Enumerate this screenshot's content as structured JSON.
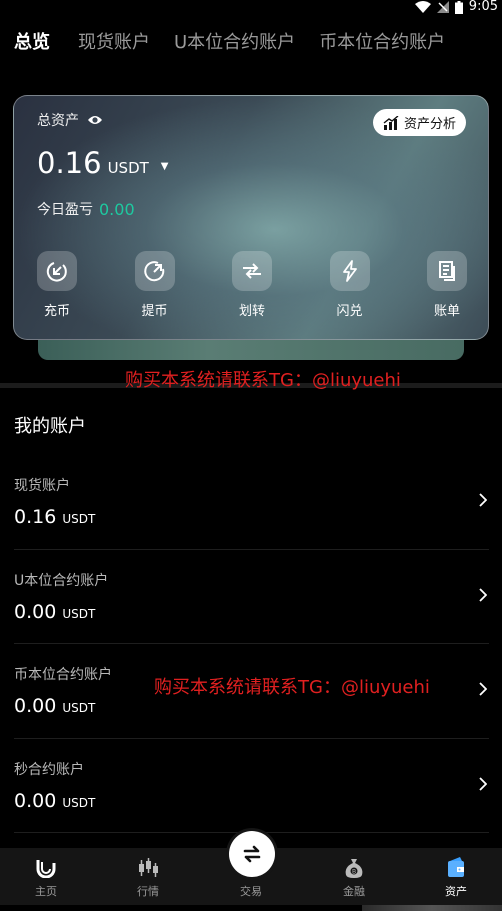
{
  "status_bar": {
    "time": "9:05",
    "icons": [
      "wifi-icon",
      "signal-icon",
      "battery-icon"
    ]
  },
  "tabs": [
    {
      "label": "总览",
      "active": true
    },
    {
      "label": "现货账户",
      "active": false
    },
    {
      "label": "U本位合约账户",
      "active": false
    },
    {
      "label": "币本位合约账户",
      "active": false
    }
  ],
  "asset_card": {
    "label": "总资产",
    "analysis_label": "资产分析",
    "balance": "0.16",
    "unit": "USDT",
    "pnl_label": "今日盈亏",
    "pnl_value": "0.00",
    "actions": [
      {
        "label": "充币",
        "icon": "deposit-icon"
      },
      {
        "label": "提币",
        "icon": "withdraw-icon"
      },
      {
        "label": "划转",
        "icon": "transfer-icon"
      },
      {
        "label": "闪兑",
        "icon": "flash-swap-icon"
      },
      {
        "label": "账单",
        "icon": "bill-icon"
      }
    ]
  },
  "watermark": {
    "text": "购买本系统请联系TG：@liuyuehi"
  },
  "my_accounts": {
    "title": "我的账户",
    "items": [
      {
        "name": "现货账户",
        "value": "0.16",
        "unit": "USDT"
      },
      {
        "name": "U本位合约账户",
        "value": "0.00",
        "unit": "USDT"
      },
      {
        "name": "币本位合约账户",
        "value": "0.00",
        "unit": "USDT"
      },
      {
        "name": "秒合约账户",
        "value": "0.00",
        "unit": "USDT"
      }
    ]
  },
  "bottom_nav": [
    {
      "label": "主页",
      "icon": "home-icon",
      "active": false
    },
    {
      "label": "行情",
      "icon": "market-icon",
      "active": false
    },
    {
      "label": "交易",
      "icon": "trade-icon",
      "active": false
    },
    {
      "label": "金融",
      "icon": "finance-icon",
      "active": false
    },
    {
      "label": "资产",
      "icon": "assets-icon",
      "active": true
    }
  ],
  "colors": {
    "accent_green": "#1ec9a0",
    "watermark_red": "#e02020",
    "background": "#000000"
  }
}
